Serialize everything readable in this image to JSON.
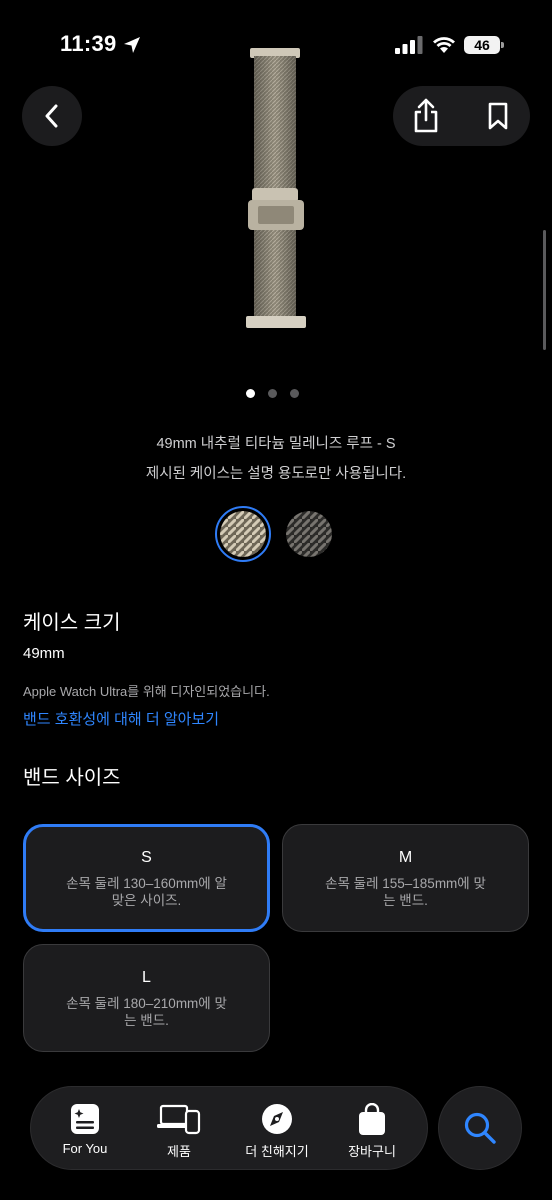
{
  "status_bar": {
    "time": "11:39",
    "battery": "46",
    "icons": [
      "location-arrow-icon",
      "cellular-signal-icon",
      "wifi-icon",
      "battery-icon"
    ]
  },
  "nav": {
    "back_icon": "chevron-left-icon",
    "share_icon": "share-icon",
    "bookmark_icon": "bookmark-icon"
  },
  "carousel": {
    "page_count": 3,
    "active_page": 1
  },
  "product": {
    "name": "49mm 내추럴 티타늄 밀레니즈 루프 - S",
    "case_notice": "제시된 케이스는 설명 용도로만 사용됩니다.",
    "swatches": [
      {
        "name": "natural-titanium",
        "color": "#a79f8f",
        "selected": true
      },
      {
        "name": "black-titanium",
        "color": "#5f5e5c",
        "selected": false
      }
    ]
  },
  "case_size": {
    "title": "케이스 크기",
    "value": "49mm",
    "designed_for": "Apple Watch Ultra를 위해 디자인되었습니다.",
    "link": "밴드 호환성에 대해 더 알아보기"
  },
  "band_size": {
    "title": "밴드 사이즈",
    "options": [
      {
        "label": "S",
        "description": "손목 둘레 130–160mm에 알맞은 사이즈.",
        "selected": true
      },
      {
        "label": "M",
        "description": "손목 둘레 155–185mm에 맞는 밴드.",
        "selected": false
      },
      {
        "label": "L",
        "description": "손목 둘레 180–210mm에 맞는 밴드.",
        "selected": false
      }
    ]
  },
  "tab_bar": {
    "tabs": [
      {
        "label": "For You",
        "icon": "for-you-icon"
      },
      {
        "label": "제품",
        "icon": "products-icon"
      },
      {
        "label": "더 친해지기",
        "icon": "compass-icon"
      },
      {
        "label": "장바구니",
        "icon": "bag-icon"
      }
    ],
    "search_icon": "search-icon"
  },
  "colors": {
    "accent": "#2f7cf6",
    "link": "#2f86ff",
    "card": "#1c1c1e",
    "background": "#000000"
  }
}
